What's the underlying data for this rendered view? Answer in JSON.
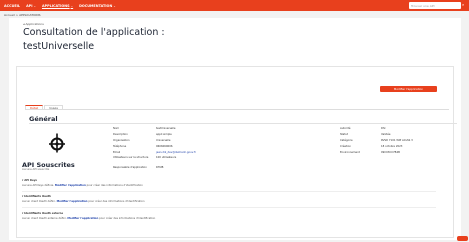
{
  "topbar": {
    "items": [
      {
        "label": "ACCUEIL",
        "active": false,
        "caret": false
      },
      {
        "label": "API",
        "active": false,
        "caret": true
      },
      {
        "label": "APPLICATIONS",
        "active": true,
        "caret": true
      },
      {
        "label": "DOCUMENTATION",
        "active": false,
        "caret": true
      }
    ],
    "search_placeholder": "Trouver une API",
    "caret_glyph": "⌄",
    "search_icon_glyph": "⌕"
  },
  "breadcrumb": "Accueil > APPLICATIONS",
  "header": {
    "back_link": "◂ Applications",
    "title_line1": "Consultation de l'application :",
    "title_line2": "testUniverselle",
    "modify_button": "Modifier l'application"
  },
  "tabs": [
    {
      "label": "Détail",
      "active": true
    },
    {
      "label": "Usage",
      "active": false
    }
  ],
  "general": {
    "heading": "Général",
    "left_fields": [
      {
        "label": "Nom",
        "value": "testUniverselle",
        "link": false
      },
      {
        "label": "Description",
        "value": "appli simple",
        "link": false
      },
      {
        "label": "Organisation",
        "value": "Universelle",
        "link": false
      },
      {
        "label": "Téléphone",
        "value": "0606060606",
        "link": false
      },
      {
        "label": "Email",
        "value": "jean.dik_dev@dsimanh.gouv.fr",
        "link": true
      },
      {
        "label": "Utilisateurs sur la structure",
        "value": "100 utilisateurs",
        "link": false
      },
      {
        "label": "Responsable d'application",
        "value": "RHUB",
        "link": false
      }
    ],
    "right_fields": [
      {
        "label": "Autorité",
        "value": "DSI"
      },
      {
        "label": "Statut",
        "value": "Validée"
      },
      {
        "label": "Catégorie",
        "value": "RVSD 7101 WIP ACLSS 3"
      },
      {
        "label": "Création",
        "value": "18 octobre 2023"
      },
      {
        "label": "Environnement",
        "value": "09C03CC7B4B"
      }
    ]
  },
  "api": {
    "heading": "API Souscrites",
    "subtitle": "Aucune API souscrite",
    "blocks": [
      {
        "head": "▾ API Keys",
        "desc_before": "Aucune API Keys définie.",
        "desc_link": "Modifier l'application",
        "desc_after": "pour créer des informations d'identification"
      },
      {
        "head": "▾ Identifiants Oauth",
        "desc_before": "Aucun client Oauth défini.",
        "desc_link": "Modifier l'application",
        "desc_after": "pour créer des informations d'identification"
      },
      {
        "head": "▾ Identifiants Oauth externe",
        "desc_before": "Aucun client Oauth externe défini.",
        "desc_link": "Modifier l'application",
        "desc_after": "pour créer des informations d'identification"
      }
    ]
  },
  "colors": {
    "brand": "#e8401d",
    "title": "#1d2433",
    "link": "#2244aa"
  }
}
